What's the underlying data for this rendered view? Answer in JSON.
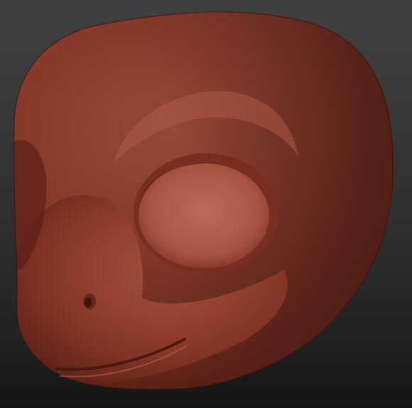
{
  "viewport": {
    "background_top": "#404040",
    "background_bottom": "#161616"
  },
  "model": {
    "subject": "sculpted-creature-head",
    "material_color": "#8e3a2c",
    "highlight_color": "#c26652",
    "shadow_color": "#4a1a12",
    "eye_socket_color": "#b45a4a",
    "wireframe_visible": true
  }
}
